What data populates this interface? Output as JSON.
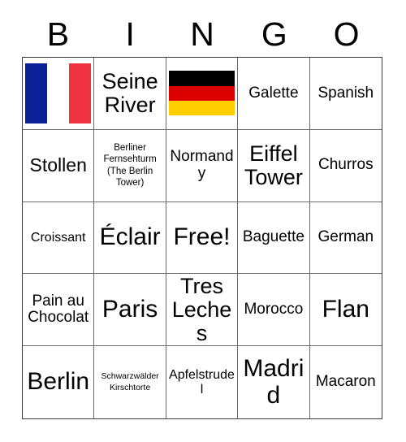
{
  "card": {
    "header_letters": [
      "B",
      "I",
      "N",
      "G",
      "O"
    ],
    "rows": [
      [
        {
          "type": "flag",
          "flag": "france",
          "label": "French flag"
        },
        {
          "type": "text",
          "text": "Seine River",
          "size": "xl"
        },
        {
          "type": "flag",
          "flag": "germany",
          "label": "German flag"
        },
        {
          "type": "text",
          "text": "Galette",
          "size": "md"
        },
        {
          "type": "text",
          "text": "Spanish",
          "size": "md"
        }
      ],
      [
        {
          "type": "text",
          "text": "Stollen",
          "size": "lg"
        },
        {
          "type": "text",
          "text": "Berliner Fernsehturm (The Berlin Tower)",
          "size": "xs"
        },
        {
          "type": "text",
          "text": "Normandy",
          "size": "md"
        },
        {
          "type": "text",
          "text": "Eiffel Tower",
          "size": "xl"
        },
        {
          "type": "text",
          "text": "Churros",
          "size": "md"
        }
      ],
      [
        {
          "type": "text",
          "text": "Croissant",
          "size": "sm"
        },
        {
          "type": "text",
          "text": "Éclair",
          "size": "xxl"
        },
        {
          "type": "text",
          "text": "Free!",
          "size": "xxl"
        },
        {
          "type": "text",
          "text": "Baguette",
          "size": "md"
        },
        {
          "type": "text",
          "text": "German",
          "size": "md"
        }
      ],
      [
        {
          "type": "text",
          "text": "Pain au Chocolat",
          "size": "md"
        },
        {
          "type": "text",
          "text": "Paris",
          "size": "xxl"
        },
        {
          "type": "text",
          "text": "Tres Leches",
          "size": "xl"
        },
        {
          "type": "text",
          "text": "Morocco",
          "size": "md"
        },
        {
          "type": "text",
          "text": "Flan",
          "size": "xxl"
        }
      ],
      [
        {
          "type": "text",
          "text": "Berlin",
          "size": "xxl"
        },
        {
          "type": "text",
          "text": "Schwarzwälder Kirschtorte",
          "size": "xxs"
        },
        {
          "type": "text",
          "text": "Apfelstrudel",
          "size": "sm"
        },
        {
          "type": "text",
          "text": "Madrid",
          "size": "xxl"
        },
        {
          "type": "text",
          "text": "Macaron",
          "size": "md"
        }
      ]
    ]
  },
  "colors": {
    "france_blue": "#0A2195",
    "france_white": "#FFFFFF",
    "france_red": "#EF3340",
    "germany_black": "#000000",
    "germany_red": "#DD0000",
    "germany_gold": "#FFCE00",
    "grid_border": "#3A3A3A",
    "cell_border": "#6B6B6B",
    "background": "#FFFFFF",
    "text": "#000000"
  }
}
